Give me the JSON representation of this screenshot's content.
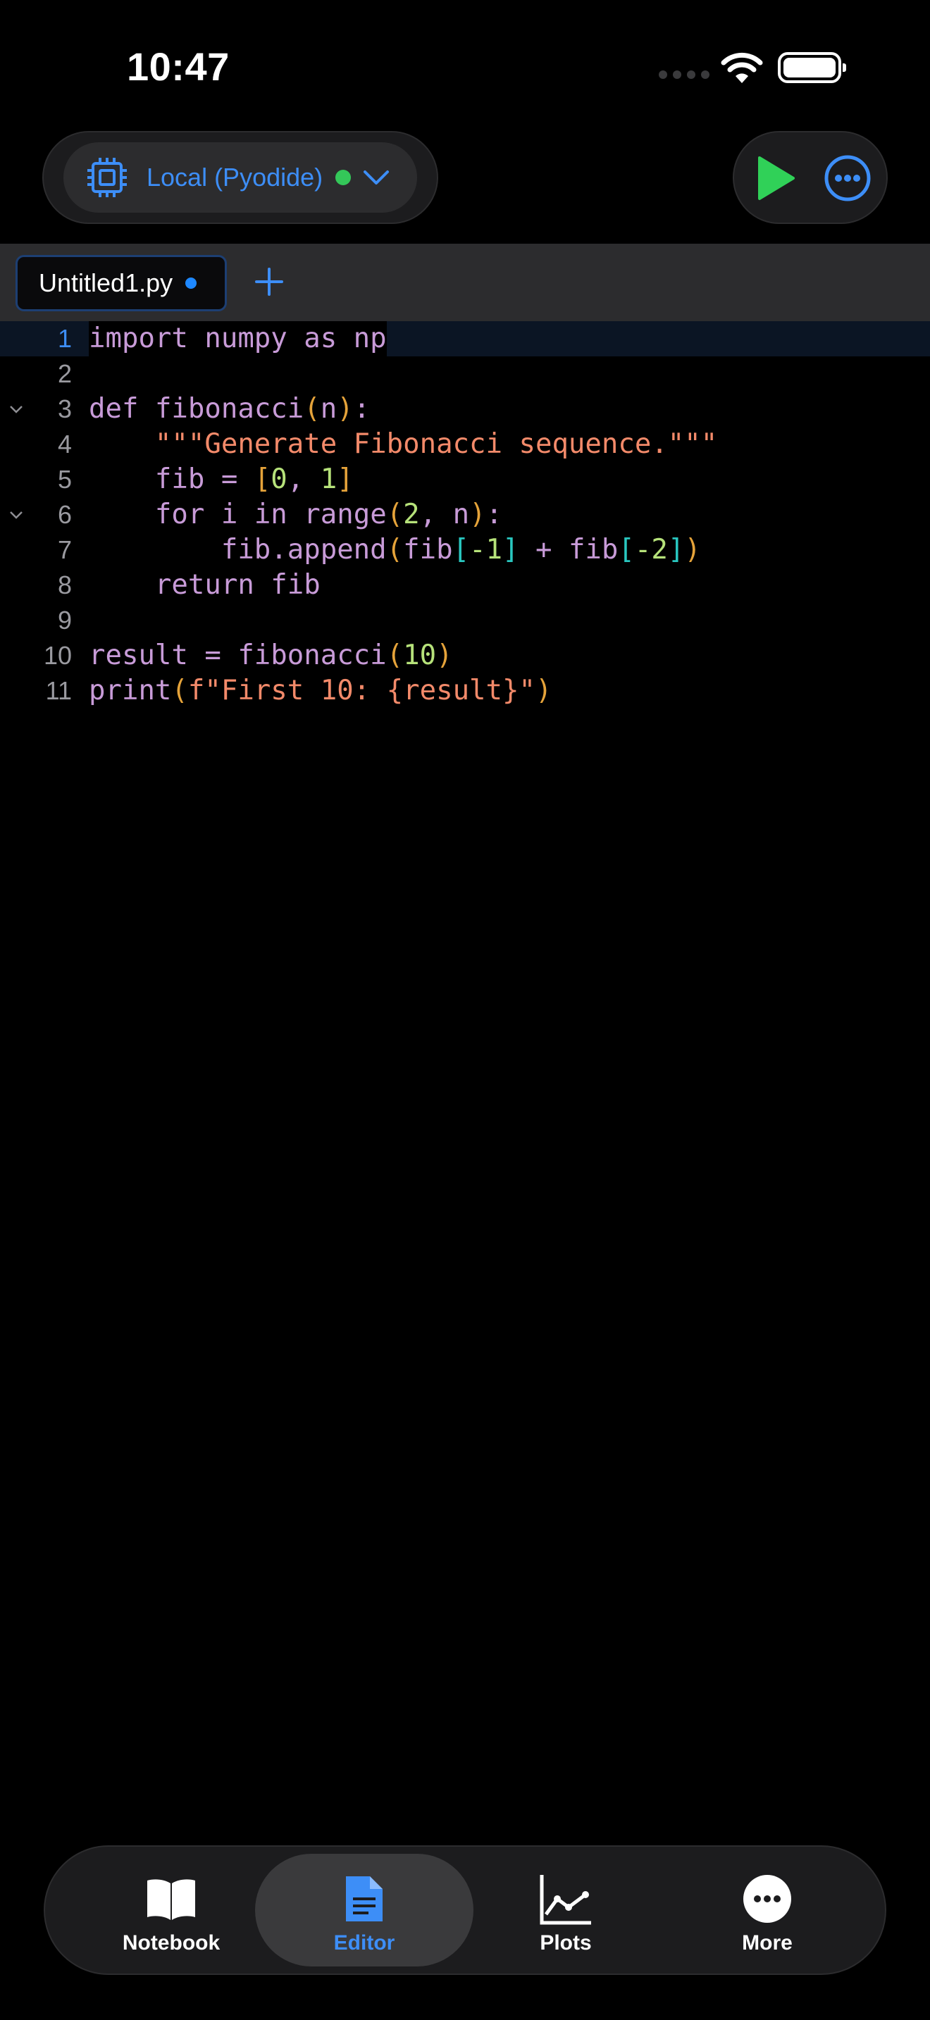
{
  "status_bar": {
    "time": "10:47"
  },
  "kernel": {
    "label": "Local (Pyodide)",
    "status": "connected",
    "status_color": "#34c759",
    "accent": "#3d8ef7"
  },
  "actions": {
    "run_icon": "play-icon",
    "more_icon": "ellipsis-circle-icon"
  },
  "tabs": [
    {
      "name": "Untitled1.py",
      "unsaved": true
    }
  ],
  "editor": {
    "active_line": 1,
    "lines": [
      "import numpy as np",
      "",
      "def fibonacci(n):",
      "    \"\"\"Generate Fibonacci sequence.\"\"\"",
      "    fib = [0, 1]",
      "    for i in range(2, n):",
      "        fib.append(fib[-1] + fib[-2])",
      "    return fib",
      "",
      "result = fibonacci(10)",
      "print(f\"First 10: {result}\")"
    ],
    "line_numbers": [
      "1",
      "2",
      "3",
      "4",
      "5",
      "6",
      "7",
      "8",
      "9",
      "10",
      "11"
    ],
    "fold_lines": [
      3,
      6
    ]
  },
  "bottom_nav": {
    "items": [
      {
        "label": "Notebook",
        "icon": "book-icon",
        "selected": false
      },
      {
        "label": "Editor",
        "icon": "document-icon",
        "selected": true
      },
      {
        "label": "Plots",
        "icon": "line-chart-icon",
        "selected": false
      },
      {
        "label": "More",
        "icon": "ellipsis-circle-icon",
        "selected": false
      }
    ]
  }
}
